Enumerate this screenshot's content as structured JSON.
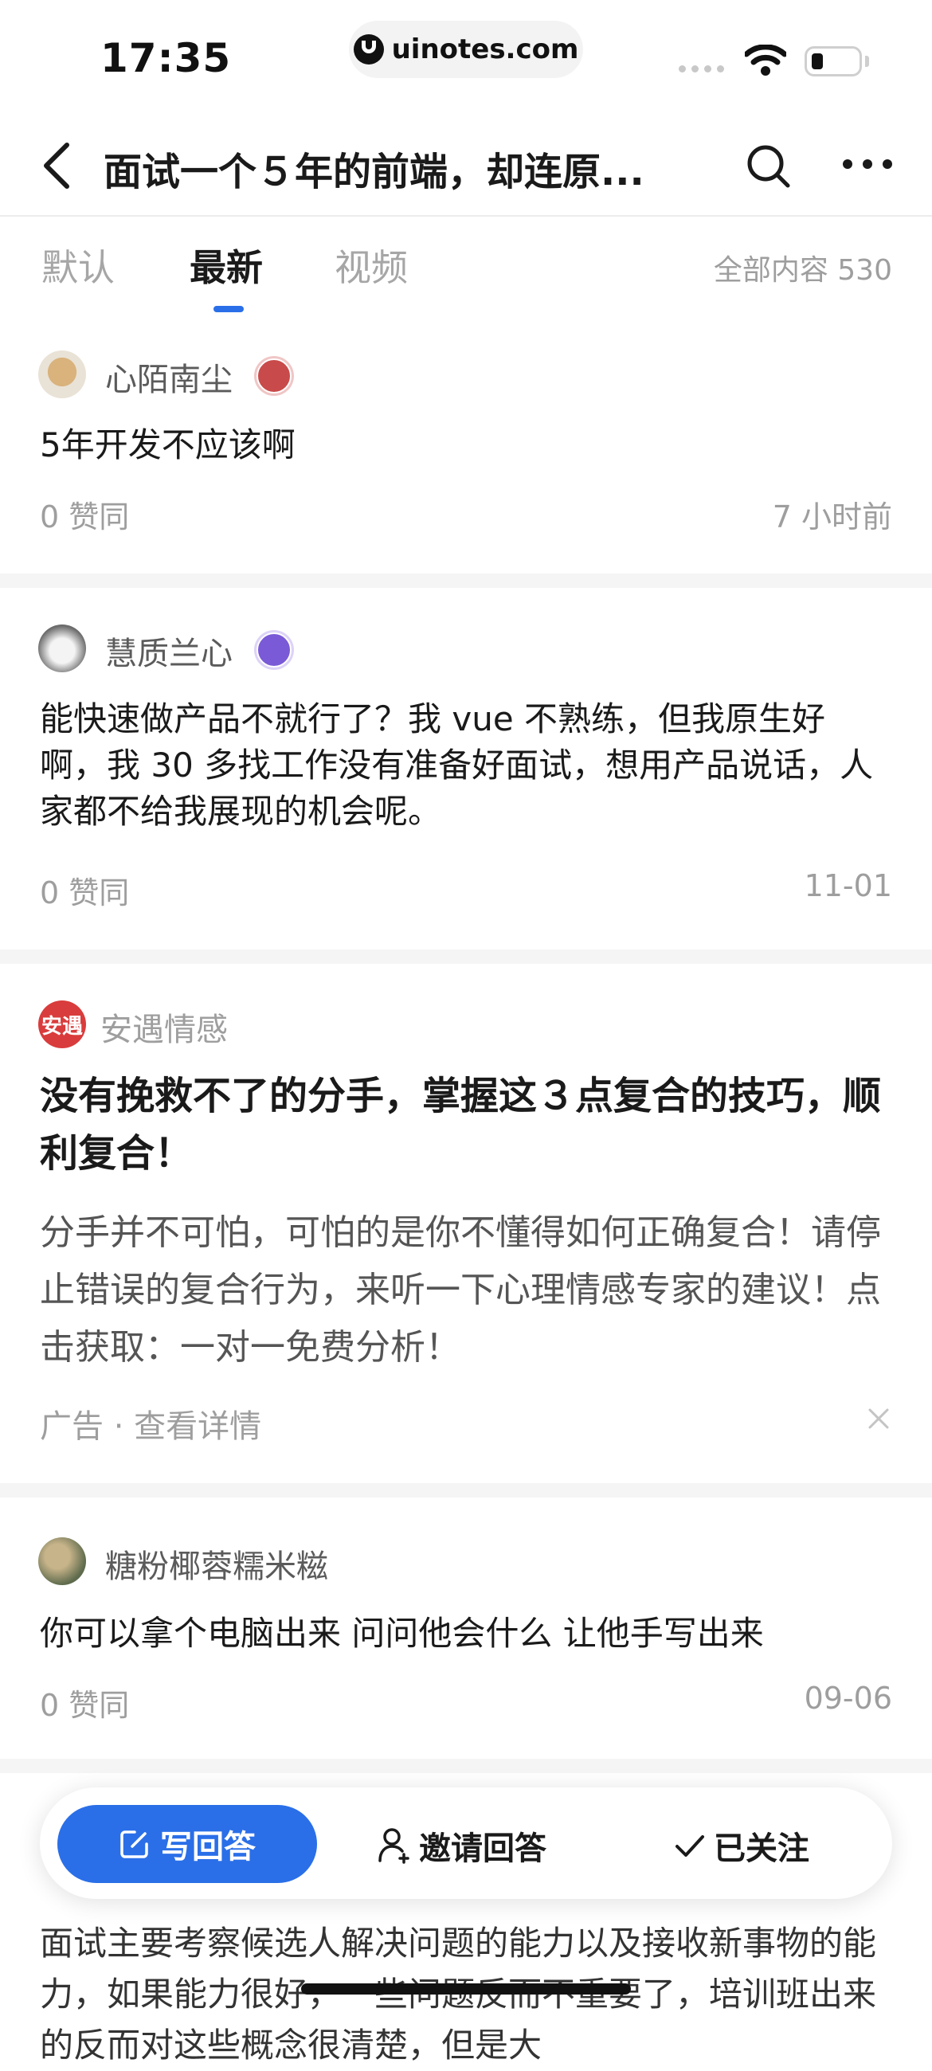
{
  "status": {
    "time": "17:35",
    "url": "uinotes.com"
  },
  "nav": {
    "title": "面试一个５年的前端，却连原..."
  },
  "tabs": {
    "items": [
      "默认",
      "最新",
      "视频"
    ],
    "active": "最新",
    "count_label": "全部内容 530"
  },
  "answers": [
    {
      "author": "心陌南尘",
      "text": "5年开发不应该啊",
      "likes": "0 赞同",
      "time": "7 小时前"
    },
    {
      "author": "慧质兰心",
      "text": "能快速做产品不就行了？我 vue 不熟练，但我原生好啊，我 30 多找工作没有准备好面试，想用产品说话，人家都不给我展现的机会呢。",
      "likes": "0 赞同",
      "time": "11-01"
    },
    {
      "author": "糖粉椰蓉糯米糍",
      "text": "你可以拿个电脑出来 问问他会什么 让他手写出来",
      "likes": "0 赞同",
      "time": "09-06"
    }
  ],
  "ad": {
    "brand": "安遇情感",
    "logo_text": "安遇",
    "title": "没有挽救不了的分手，掌握这３点复合的技巧，顺利复合！",
    "body": "分手并不可怕，可怕的是你不懂得如何正确复合！请停止错误的复合行为，来听一下心理情感专家的建议！点击获取：一对一免费分析！",
    "footer": "广告 · 查看详情"
  },
  "partial_answer": {
    "text": "面试主要考察候选人解决问题的能力以及接收新事物的能力，如果能力很好，一些问题反而不重要了，培训班出来的反而对这些概念很清楚，但是大"
  },
  "bottom_bar": {
    "write": "写回答",
    "invite": "邀请回答",
    "follow": "已关注"
  },
  "colors": {
    "accent": "#2a6fe8",
    "text": "#1a1a1a",
    "muted": "#9e9e9e"
  }
}
